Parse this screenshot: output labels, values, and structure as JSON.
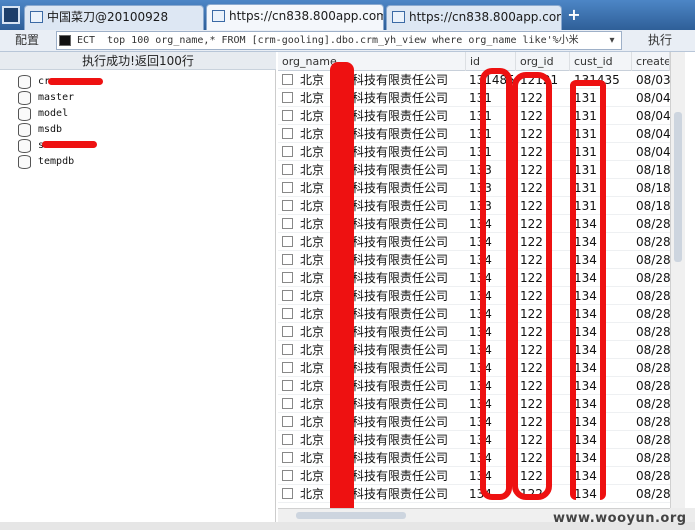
{
  "tabs": [
    {
      "label": "中国菜刀@20100928",
      "active": false
    },
    {
      "label": "https://cn838.800app.com/U...",
      "active": true
    },
    {
      "label": "https://cn838.800app.com/U...",
      "active": false
    }
  ],
  "toolbar": {
    "config_label": "配置",
    "sql_value": "ECT  top 100 org_name,* FROM [crm-gooling].dbo.crm_yh_view where org_name like'%小米",
    "exec_label": "执行"
  },
  "status_text": "执行成功!返回100行",
  "databases": [
    "cr",
    "master",
    "model",
    "msdb",
    "s",
    "tempdb"
  ],
  "columns": [
    "org_name",
    "id",
    "org_id",
    "cust_id",
    "create"
  ],
  "rows": [
    {
      "org": "北京",
      "suffix": "科技有限责任公司",
      "id": "131485",
      "orgid": "12121",
      "cust": "131435",
      "create": "08/03."
    },
    {
      "org": "北京",
      "suffix": "科技有限责任公司",
      "id": "131",
      "orgid": "122",
      "cust": "131",
      "create": "08/04."
    },
    {
      "org": "北京",
      "suffix": "科技有限责任公司",
      "id": "131",
      "orgid": "122",
      "cust": "131",
      "create": "08/04."
    },
    {
      "org": "北京",
      "suffix": "科技有限责任公司",
      "id": "131",
      "orgid": "122",
      "cust": "131",
      "create": "08/04."
    },
    {
      "org": "北京",
      "suffix": "科技有限责任公司",
      "id": "131",
      "orgid": "122",
      "cust": "131",
      "create": "08/04."
    },
    {
      "org": "北京",
      "suffix": "科技有限责任公司",
      "id": "133",
      "orgid": "122",
      "cust": "131",
      "create": "08/18."
    },
    {
      "org": "北京",
      "suffix": "科技有限责任公司",
      "id": "133",
      "orgid": "122",
      "cust": "131",
      "create": "08/18."
    },
    {
      "org": "北京",
      "suffix": "科技有限责任公司",
      "id": "133",
      "orgid": "122",
      "cust": "131",
      "create": "08/18."
    },
    {
      "org": "北京",
      "suffix": "科技有限责任公司",
      "id": "134",
      "orgid": "122",
      "cust": "134",
      "create": "08/28."
    },
    {
      "org": "北京",
      "suffix": "科技有限责任公司",
      "id": "134",
      "orgid": "122",
      "cust": "134",
      "create": "08/28."
    },
    {
      "org": "北京",
      "suffix": "科技有限责任公司",
      "id": "134",
      "orgid": "122",
      "cust": "134",
      "create": "08/28."
    },
    {
      "org": "北京",
      "suffix": "科技有限责任公司",
      "id": "134",
      "orgid": "122",
      "cust": "134",
      "create": "08/28."
    },
    {
      "org": "北京",
      "suffix": "科技有限责任公司",
      "id": "134",
      "orgid": "122",
      "cust": "134",
      "create": "08/28."
    },
    {
      "org": "北京",
      "suffix": "科技有限责任公司",
      "id": "134",
      "orgid": "122",
      "cust": "134",
      "create": "08/28."
    },
    {
      "org": "北京",
      "suffix": "科技有限责任公司",
      "id": "134",
      "orgid": "122",
      "cust": "134",
      "create": "08/28."
    },
    {
      "org": "北京",
      "suffix": "科技有限责任公司",
      "id": "134",
      "orgid": "122",
      "cust": "134",
      "create": "08/28."
    },
    {
      "org": "北京",
      "suffix": "科技有限责任公司",
      "id": "134",
      "orgid": "122",
      "cust": "134",
      "create": "08/28."
    },
    {
      "org": "北京",
      "suffix": "科技有限责任公司",
      "id": "134",
      "orgid": "122",
      "cust": "134",
      "create": "08/28."
    },
    {
      "org": "北京",
      "suffix": "科技有限责任公司",
      "id": "134",
      "orgid": "122",
      "cust": "134",
      "create": "08/28."
    },
    {
      "org": "北京",
      "suffix": "科技有限责任公司",
      "id": "134",
      "orgid": "122",
      "cust": "134",
      "create": "08/28."
    },
    {
      "org": "北京",
      "suffix": "科技有限责任公司",
      "id": "134",
      "orgid": "122",
      "cust": "134",
      "create": "08/28."
    },
    {
      "org": "北京",
      "suffix": "科技有限责任公司",
      "id": "134",
      "orgid": "122",
      "cust": "134",
      "create": "08/28."
    },
    {
      "org": "北京",
      "suffix": "科技有限责任公司",
      "id": "134",
      "orgid": "122",
      "cust": "134",
      "create": "08/28."
    },
    {
      "org": "北京",
      "suffix": "科技有限责任公司",
      "id": "134",
      "orgid": "122",
      "cust": "134",
      "create": "08/28."
    }
  ],
  "watermark": "www.wooyun.org",
  "colors": {
    "redaction": "#e11111",
    "tabbar": "#2f5f98"
  }
}
